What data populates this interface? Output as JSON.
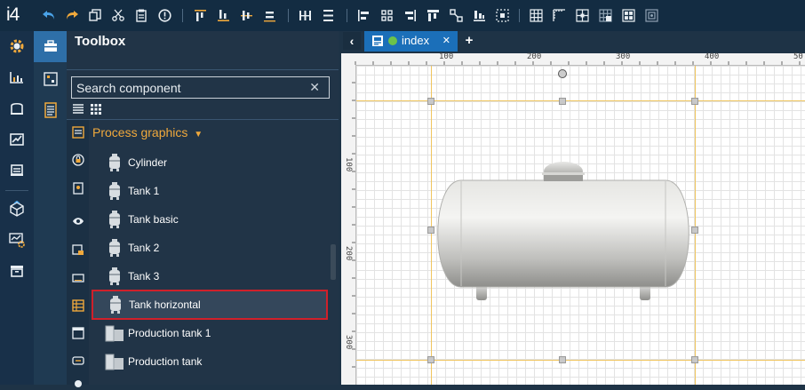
{
  "app": {
    "logo": "i4"
  },
  "toolbar": {
    "buttons": [
      "undo-icon",
      "redo-icon",
      "copy-icon",
      "cut-icon",
      "paste-icon",
      "info-icon",
      "align-top-icon",
      "align-bottom-icon",
      "align-middle-icon",
      "align-center-v-icon",
      "distribute-h-icon",
      "distribute-v-icon",
      "align-left-icon",
      "align-center-h-icon",
      "align-right-icon",
      "same-width-icon",
      "same-size-icon",
      "same-height-icon",
      "center-icon",
      "grid-icon",
      "rulers-icon",
      "snap-icon",
      "snap-grid-icon",
      "snap-objects-icon",
      "frame-icon"
    ]
  },
  "panel": {
    "title": "Toolbox",
    "search_placeholder": "Search component",
    "group_title": "Process graphics",
    "items": [
      {
        "label": "Cylinder",
        "icon": "tank-icon"
      },
      {
        "label": "Tank 1",
        "icon": "tank-icon"
      },
      {
        "label": "Tank basic",
        "icon": "tank-icon"
      },
      {
        "label": "Tank 2",
        "icon": "tank-icon"
      },
      {
        "label": "Tank 3",
        "icon": "tank-icon"
      },
      {
        "label": "Tank horizontal",
        "icon": "tank-icon",
        "selected": true
      },
      {
        "label": "Production tank 1",
        "icon": "production-tank-icon"
      },
      {
        "label": "Production tank",
        "icon": "production-tank-icon"
      }
    ]
  },
  "editor": {
    "tab_label": "index",
    "ruler_top": [
      "100",
      "200",
      "300",
      "400",
      "50"
    ],
    "ruler_left": [
      "100",
      "200",
      "300"
    ]
  },
  "colors": {
    "accent": "#1b6fb9",
    "group_title": "#f0a93c",
    "selection": "#d0202a"
  }
}
